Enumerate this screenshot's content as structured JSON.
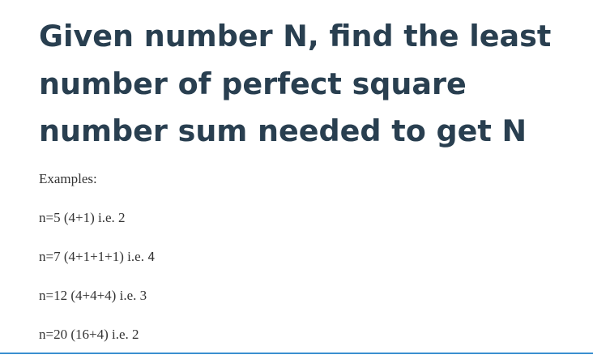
{
  "title": "Given number N, find the least number of perfect square number sum needed to get N",
  "intro": "Examples:",
  "examples": [
    {
      "expr": "n=5 (4+1)",
      "label": "i.e.",
      "answer": "2"
    },
    {
      "expr": "n=7 (4+1+1+1)",
      "label": "i.e.",
      "answer": "4"
    },
    {
      "expr": "n=12 (4+4+4)",
      "label": "i.e.",
      "answer": "3"
    },
    {
      "expr": "n=20 (16+4)",
      "label": "i.e.",
      "answer": "2"
    }
  ],
  "colors": {
    "title": "#293f50",
    "body": "#333333",
    "rule": "#3a8fd0"
  }
}
